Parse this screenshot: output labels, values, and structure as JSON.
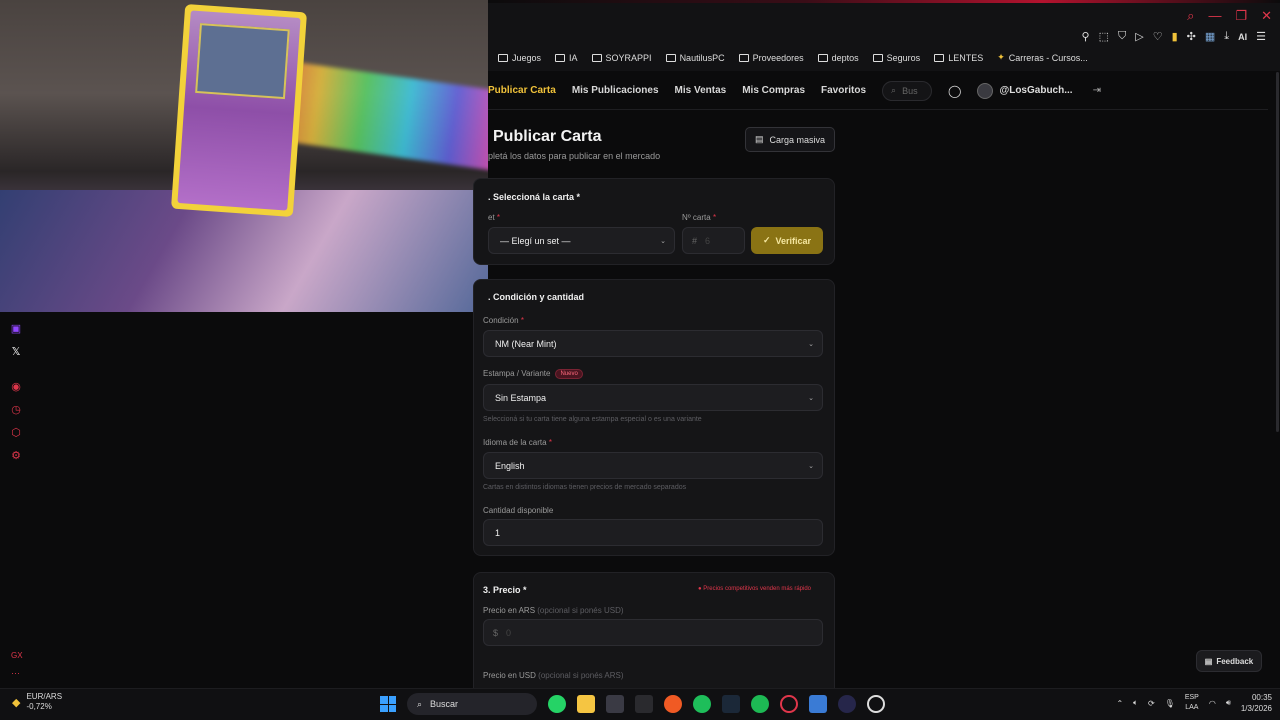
{
  "browser": {
    "bookmarks": [
      "Juegos",
      "IA",
      "SOYRAPPI",
      "NautilusPC",
      "Proveedores",
      "deptos",
      "Seguros",
      "LENTES",
      "Carreras - Cursos..."
    ],
    "ai_label": "AI"
  },
  "nav": {
    "items": [
      "Publicar Carta",
      "Mis Publicaciones",
      "Mis Ventas",
      "Mis Compras",
      "Favoritos"
    ],
    "search_placeholder": "Bus",
    "username": "@LosGabuch..."
  },
  "page": {
    "title": "Publicar Carta",
    "subtitle": "pletá los datos para publicar en el mercado",
    "bulk_button": "Carga masiva"
  },
  "section1": {
    "title": ". Seleccioná la carta *",
    "set_label": "et",
    "set_value": "— Elegí un set —",
    "number_label": "Nº carta",
    "number_placeholder": "6",
    "verify_button": "Verificar"
  },
  "section2": {
    "title": ". Condición y cantidad",
    "condition_label": "Condición",
    "condition_value": "NM (Near Mint)",
    "stamp_label": "Estampa / Variante",
    "stamp_badge": "Nuevo",
    "stamp_value": "Sin Estampa",
    "stamp_hint": "Seleccioná si tu carta tiene alguna estampa especial o es una variante",
    "language_label": "Idioma de la carta",
    "language_value": "English",
    "language_hint": "Cartas en distintos idiomas tienen precios de mercado separados",
    "qty_label": "Cantidad disponible",
    "qty_value": "1"
  },
  "section3": {
    "title": "3. Precio *",
    "competitive_note": "● Precios competitivos venden más rápido",
    "ars_label": "Precio en ARS",
    "ars_optional": "(opcional si ponés USD)",
    "ars_currency": "$",
    "ars_placeholder": "0",
    "usd_label": "Precio en USD",
    "usd_optional": "(opcional si ponés ARS)"
  },
  "feedback_label": "Feedback",
  "taskbar": {
    "search_label": "Buscar",
    "ticker_name": "EUR/ARS",
    "ticker_change": "-0,72%",
    "lang_line1": "ESP",
    "lang_line2": "LAA",
    "time": "00:35",
    "date": "1/3/2026"
  },
  "colors": {
    "accent": "#f0c23a",
    "verify_bg": "#8a7314",
    "danger": "#e0364b",
    "panel_bg": "#151517"
  }
}
